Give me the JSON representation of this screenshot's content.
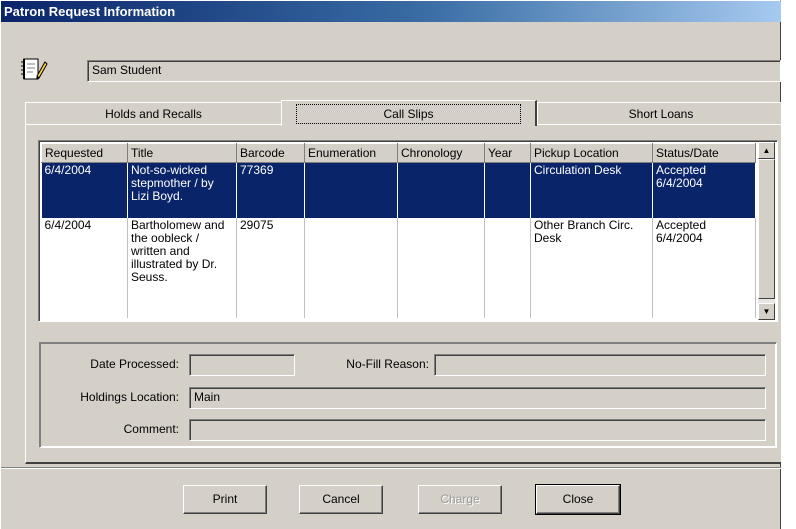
{
  "window": {
    "title": "Patron Request Information"
  },
  "patron": {
    "name": "Sam Student"
  },
  "tabs": [
    {
      "label": "Holds and Recalls"
    },
    {
      "label": "Call Slips"
    },
    {
      "label": "Short Loans"
    }
  ],
  "grid": {
    "columns": [
      "Requested",
      "Title",
      "Barcode",
      "Enumeration",
      "Chronology",
      "Year",
      "Pickup Location",
      "Status/Date"
    ],
    "rows": [
      [
        "6/4/2004",
        "Not-so-wicked stepmother / by Lizi Boyd.",
        "77369",
        "",
        "",
        "",
        "Circulation Desk",
        "Accepted 6/4/2004"
      ],
      [
        "6/4/2004",
        "Bartholomew and the oobleck / written and illustrated by Dr. Seuss.",
        "29075",
        "",
        "",
        "",
        "Other Branch Circ. Desk",
        "Accepted 6/4/2004"
      ]
    ]
  },
  "details": {
    "date_processed_label": "Date Processed:",
    "date_processed_value": "",
    "nofill_label": "No-Fill Reason:",
    "nofill_value": "",
    "holdings_label": "Holdings Location:",
    "holdings_value": "Main",
    "comment_label": "Comment:",
    "comment_value": ""
  },
  "buttons": {
    "print": "Print",
    "cancel": "Cancel",
    "charge": "Charge",
    "close": "Close"
  },
  "colors": {
    "titlebar_start": "#0a246a",
    "selection": "#0a246a",
    "face": "#d4d0c8"
  },
  "icons": {
    "patron": "patron-notebook-pencil-icon",
    "scroll_up": "arrow-up-icon",
    "scroll_down": "arrow-down-icon"
  }
}
